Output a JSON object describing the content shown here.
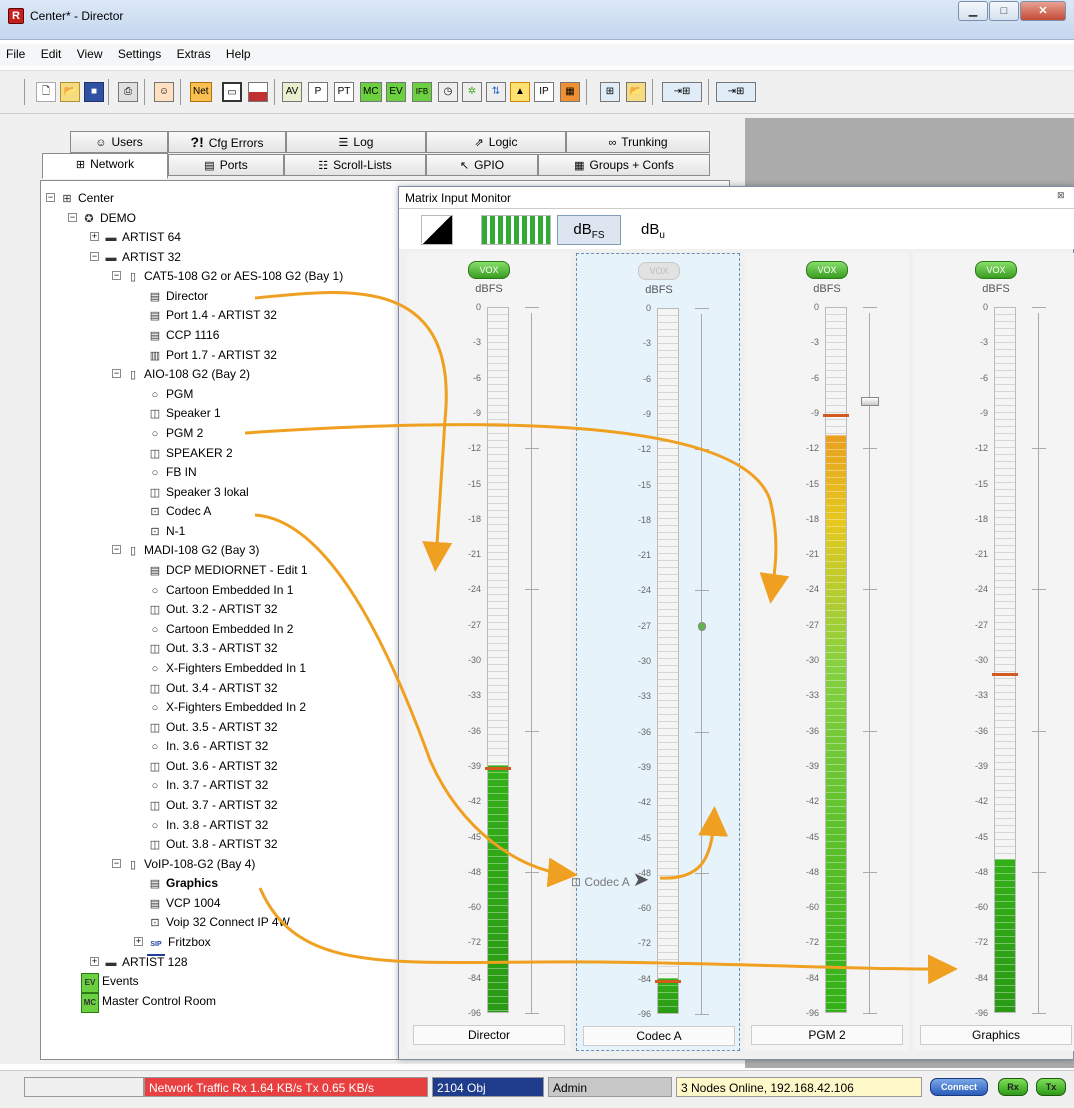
{
  "window": {
    "title": "Center* - Director"
  },
  "menu": [
    "File",
    "Edit",
    "View",
    "Settings",
    "Extras",
    "Help"
  ],
  "toolbar": {
    "net_label": "Net",
    "icons": [
      "new-icon",
      "open-icon",
      "save-icon",
      "print-icon",
      "user-icon",
      "net-icon",
      "panel-icon",
      "flag-icon",
      "av-icon",
      "p-icon",
      "pt-icon",
      "mc-icon",
      "ev-icon",
      "ifb-icon",
      "clock-icon",
      "gpio-icon",
      "network-icon",
      "warning-icon",
      "ip-icon",
      "matrix-icon",
      "tree-icon",
      "folder-icon",
      "export-icon",
      "import-icon"
    ],
    "text_buttons": {
      "av": "AV",
      "p": "P",
      "pt": "PT",
      "mc": "MC",
      "ev": "EV",
      "ifb": "IFB",
      "ip": "IP"
    }
  },
  "tabs_top": [
    {
      "label": "Users",
      "icon": "users-icon"
    },
    {
      "label": "Cfg Errors",
      "icon": "error-icon"
    },
    {
      "label": "Log",
      "icon": "log-icon"
    },
    {
      "label": "Logic",
      "icon": "logic-icon"
    },
    {
      "label": "Trunking",
      "icon": "trunking-icon"
    }
  ],
  "tabs_bottom": [
    {
      "label": "Network",
      "icon": "network-icon"
    },
    {
      "label": "Ports",
      "icon": "ports-icon"
    },
    {
      "label": "Scroll-Lists",
      "icon": "list-icon"
    },
    {
      "label": "GPIO",
      "icon": "gpio-icon"
    },
    {
      "label": "Groups + Confs",
      "icon": "groups-icon"
    }
  ],
  "tree": [
    {
      "label": "Center",
      "level": 0,
      "icon": "network-icon",
      "expander": "-"
    },
    {
      "label": "DEMO",
      "level": 1,
      "icon": "globe-icon",
      "expander": "-"
    },
    {
      "label": "ARTIST 64",
      "level": 2,
      "icon": "frame-icon",
      "expander": "+"
    },
    {
      "label": "ARTIST 32",
      "level": 2,
      "icon": "frame-icon",
      "expander": "-"
    },
    {
      "label": "CAT5-108 G2 or AES-108 G2 (Bay  1)",
      "level": 3,
      "icon": "card-icon",
      "expander": "-"
    },
    {
      "label": "Director",
      "level": 4,
      "icon": "panel-icon"
    },
    {
      "label": "Port 1.4 - ARTIST 32",
      "level": 4,
      "icon": "panel-icon"
    },
    {
      "label": "CCP 1116",
      "level": 4,
      "icon": "panel-icon"
    },
    {
      "label": "Port 1.7 - ARTIST 32",
      "level": 4,
      "icon": "port-icon"
    },
    {
      "label": "AIO-108 G2 (Bay  2)",
      "level": 3,
      "icon": "card-icon",
      "expander": "-"
    },
    {
      "label": "PGM",
      "level": 4,
      "icon": "input-icon"
    },
    {
      "label": "Speaker 1",
      "level": 4,
      "icon": "speaker-icon"
    },
    {
      "label": "PGM 2",
      "level": 4,
      "icon": "input-icon"
    },
    {
      "label": "SPEAKER 2",
      "level": 4,
      "icon": "speaker-icon"
    },
    {
      "label": "FB IN",
      "level": 4,
      "icon": "input-icon"
    },
    {
      "label": "Speaker 3 lokal",
      "level": 4,
      "icon": "speaker-icon"
    },
    {
      "label": "Codec A",
      "level": 4,
      "icon": "codec-icon"
    },
    {
      "label": "N-1",
      "level": 4,
      "icon": "codec-icon"
    },
    {
      "label": "MADI-108 G2 (Bay  3)",
      "level": 3,
      "icon": "card-icon",
      "expander": "-"
    },
    {
      "label": "DCP MEDIORNET - Edit 1",
      "level": 4,
      "icon": "panel-icon"
    },
    {
      "label": "Cartoon Embedded In 1",
      "level": 4,
      "icon": "input-icon"
    },
    {
      "label": "Out. 3.2 - ARTIST 32",
      "level": 4,
      "icon": "speaker-icon"
    },
    {
      "label": "Cartoon Embedded In 2",
      "level": 4,
      "icon": "input-icon"
    },
    {
      "label": "Out. 3.3 - ARTIST 32",
      "level": 4,
      "icon": "speaker-icon"
    },
    {
      "label": "X-Fighters Embedded In 1",
      "level": 4,
      "icon": "input-icon"
    },
    {
      "label": "Out. 3.4 - ARTIST 32",
      "level": 4,
      "icon": "speaker-icon"
    },
    {
      "label": "X-Fighters Embedded In 2",
      "level": 4,
      "icon": "input-icon"
    },
    {
      "label": "Out. 3.5 - ARTIST 32",
      "level": 4,
      "icon": "speaker-icon"
    },
    {
      "label": "In. 3.6 - ARTIST 32",
      "level": 4,
      "icon": "input-icon"
    },
    {
      "label": "Out. 3.6 - ARTIST 32",
      "level": 4,
      "icon": "speaker-icon"
    },
    {
      "label": "In. 3.7 - ARTIST 32",
      "level": 4,
      "icon": "input-icon"
    },
    {
      "label": "Out. 3.7 - ARTIST 32",
      "level": 4,
      "icon": "speaker-icon"
    },
    {
      "label": "In. 3.8 - ARTIST 32",
      "level": 4,
      "icon": "input-icon"
    },
    {
      "label": "Out. 3.8 - ARTIST 32",
      "level": 4,
      "icon": "speaker-icon"
    },
    {
      "label": "VoIP-108-G2 (Bay  4)",
      "level": 3,
      "icon": "card-icon",
      "expander": "-"
    },
    {
      "label": "Graphics",
      "level": 4,
      "icon": "panel-icon",
      "bold": true
    },
    {
      "label": "VCP 1004",
      "level": 4,
      "icon": "panel-icon"
    },
    {
      "label": "Voip 32 Connect IP 4W",
      "level": 4,
      "icon": "codec-icon"
    },
    {
      "label": "Fritzbox",
      "level": 4,
      "icon": "sip-icon",
      "expander": "+",
      "icon_text": "SIP"
    },
    {
      "label": "ARTIST 128",
      "level": 2,
      "icon": "frame-icon",
      "expander": "+"
    },
    {
      "label": "Events",
      "level": 1,
      "icon": "events-icon",
      "icon_text": "EV"
    },
    {
      "label": "Master Control Room",
      "level": 1,
      "icon": "mcr-icon",
      "icon_text": "MC"
    }
  ],
  "monitor": {
    "title": "Matrix Input Monitor",
    "tools": {
      "dbfs_main": "dB",
      "dbfs_sub": "FS",
      "dbu_main": "dB",
      "dbu_sub": "u"
    },
    "vox_label": "VOX",
    "unit_label": "dBFS",
    "scale": [
      "0",
      "-3",
      "-6",
      "-9",
      "-12",
      "-15",
      "-18",
      "-21",
      "-24",
      "-27",
      "-30",
      "-33",
      "-36",
      "-39",
      "-42",
      "-45",
      "-48",
      "-60",
      "-72",
      "-84",
      "-96"
    ],
    "channels": [
      {
        "name": "Director",
        "level_db": -39,
        "fader_db": null,
        "vox_active": true,
        "peak_db": -39
      },
      {
        "name": "Codec A",
        "level_db": -84,
        "fader_db": -27,
        "vox_active": false,
        "selected": true,
        "peak_db": -84
      },
      {
        "name": "PGM 2",
        "level_db": -11,
        "fader_db": -8,
        "vox_active": true,
        "peak_db": -9
      },
      {
        "name": "Graphics",
        "level_db": -47,
        "fader_db": null,
        "vox_active": true,
        "peak_db": -31
      }
    ],
    "drag_label": "Codec A"
  },
  "status": {
    "traffic": "Network Traffic Rx 1.64 KB/s  Tx 0.65 KB/s",
    "objects": "2104 Obj",
    "user": "Admin",
    "nodes": "3 Nodes Online, 192.168.42.106",
    "connect": "Connect",
    "rx": "Rx",
    "tx": "Tx"
  },
  "colors": {
    "accent_orange": "#f0a020",
    "meter_green": "#33b018",
    "meter_yellow": "#e6c81f",
    "traffic_red": "#e84040",
    "objects_blue": "#1f3c8c",
    "nodes_yellow": "#fff8c8"
  }
}
